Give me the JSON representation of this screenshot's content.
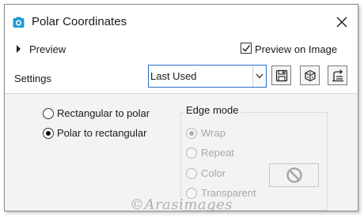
{
  "window": {
    "title": "Polar Coordinates"
  },
  "icons": {
    "app": "camera-icon",
    "close": "close-icon",
    "save": "save-icon",
    "reset": "dice-icon",
    "load": "load-preset-icon",
    "none": "no-symbol-icon"
  },
  "colors": {
    "accent": "#2b6fc9",
    "content_bg": "#f3f3f3",
    "disabled_text": "#a8a8a8"
  },
  "preview": {
    "label": "Preview",
    "on_image_label": "Preview on Image",
    "on_image_checked": true
  },
  "settings": {
    "label": "Settings",
    "selected": "Last Used"
  },
  "conversion": {
    "options": [
      {
        "label": "Rectangular to polar",
        "selected": false
      },
      {
        "label": "Polar to rectangular",
        "selected": true
      }
    ]
  },
  "edge_mode": {
    "title": "Edge mode",
    "options": [
      {
        "label": "Wrap",
        "selected": true,
        "enabled": false
      },
      {
        "label": "Repeat",
        "selected": false,
        "enabled": false
      },
      {
        "label": "Color",
        "selected": false,
        "enabled": false
      },
      {
        "label": "Transparent",
        "selected": false,
        "enabled": false
      }
    ]
  },
  "watermark": {
    "text": "©Arasimages"
  }
}
